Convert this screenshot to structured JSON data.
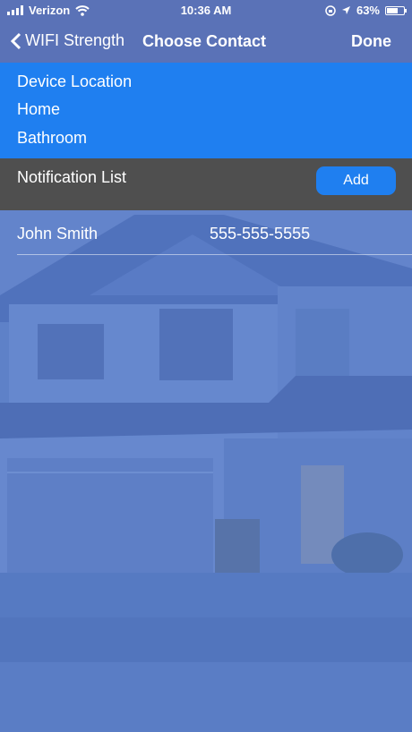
{
  "status_bar": {
    "carrier": "Verizon",
    "time": "10:36 AM",
    "battery": "63%"
  },
  "nav": {
    "back_label": "WIFI Strength",
    "title": "Choose Contact",
    "done_label": "Done"
  },
  "device": {
    "heading": "Device Location",
    "location": "Home",
    "room": "Bathroom"
  },
  "notification": {
    "title": "Notification List",
    "add_label": "Add"
  },
  "contacts": [
    {
      "name": "John Smith",
      "phone": "555-555-5555"
    }
  ],
  "colors": {
    "accent": "#1f7ff0",
    "nav_bg": "#5a72b7",
    "header_bg": "#4f4f4f",
    "overlay": "#5b7ec6"
  },
  "icons": {
    "back": "chevron-left-icon",
    "wifi": "wifi-icon",
    "signal": "signal-bars-icon",
    "location": "location-arrow-icon",
    "lock": "orientation-lock-icon",
    "battery": "battery-icon"
  }
}
